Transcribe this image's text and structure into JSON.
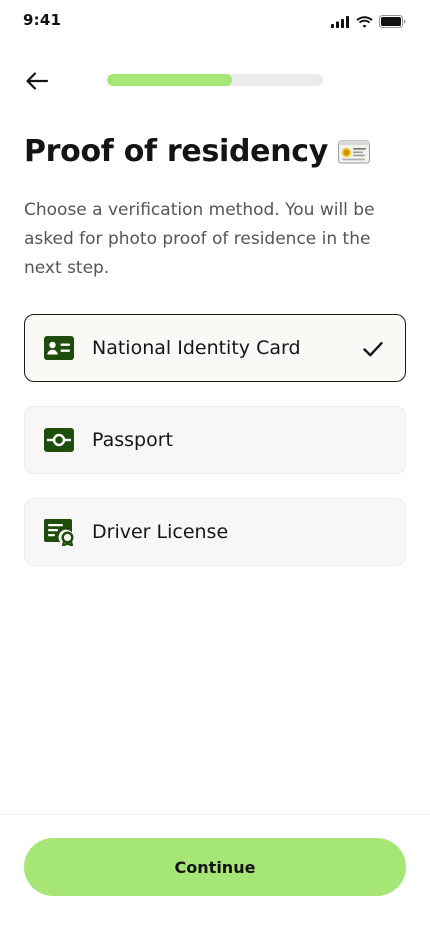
{
  "status_bar": {
    "time": "9:41",
    "icons": [
      "cellular-signal-icon",
      "wifi-icon",
      "battery-icon"
    ]
  },
  "header": {
    "back_icon": "arrow-left-icon",
    "progress_percent": 58
  },
  "title": {
    "text": "Proof of residency",
    "emoji": "identification-card-emoji"
  },
  "description": "Choose a verification method. You will be asked for photo proof of residence in the next step.",
  "options": [
    {
      "label": "National Identity Card",
      "icon": "id-card-icon",
      "selected": true
    },
    {
      "label": "Passport",
      "icon": "passport-icon",
      "selected": false
    },
    {
      "label": "Driver License",
      "icon": "license-certificate-icon",
      "selected": false
    }
  ],
  "footer": {
    "continue_label": "Continue"
  },
  "colors": {
    "accent": "#a6e676",
    "icon_green": "#1e4d0c",
    "text_dark": "#141414",
    "text_muted": "#555555"
  }
}
